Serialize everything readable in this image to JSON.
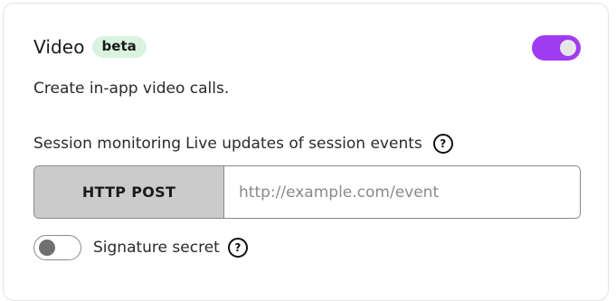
{
  "feature": {
    "title": "Video",
    "badge": "beta",
    "description": "Create in-app video calls.",
    "enabled": true
  },
  "session_monitoring": {
    "label": "Session monitoring",
    "description": "Live updates of session events",
    "help_icon": "question-circle-icon",
    "method_label": "HTTP POST",
    "url_value": "",
    "url_placeholder": "http://example.com/event"
  },
  "signature": {
    "label": "Signature secret",
    "enabled": false,
    "help_icon": "question-circle-icon"
  },
  "colors": {
    "toggle_on": "#a03cf0",
    "badge_bg": "#d9f3df",
    "method_bg": "#cbcbcb"
  }
}
